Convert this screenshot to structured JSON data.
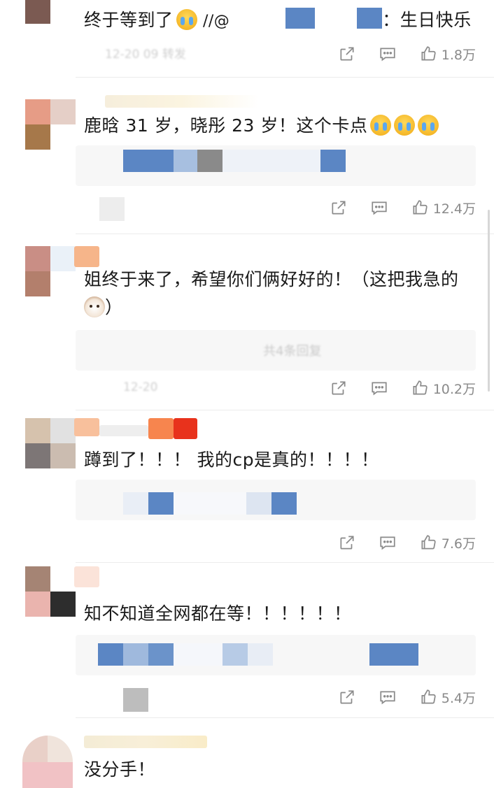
{
  "comments": [
    {
      "text": "终于等到了",
      "mention_prefix": "//@",
      "mention_suffix": "：生日快乐",
      "likes": "1.8万",
      "emoji": "cry-emoji"
    },
    {
      "text": "鹿晗 31 岁，晓彤 23 岁！这个卡点",
      "likes": "12.4万",
      "emoji": "cry-emoji"
    },
    {
      "text_line1": "姐终于来了，希望你们俩好好的！（这把我急的",
      "text_line2": "）",
      "likes": "10.2万",
      "emoji": "cat-emoji"
    },
    {
      "text": "蹲到了！！！ 我的cp是真的！！！！",
      "likes": "7.6万"
    },
    {
      "text": "知不知道全网都在等！！！！！！",
      "likes": "5.4万"
    },
    {
      "text": "没分手！"
    }
  ],
  "icons": {
    "share": "share-icon",
    "comment": "comment-icon",
    "like": "thumbs-up-icon"
  },
  "colors": {
    "mosaic_blue": "#5b86c4",
    "like_gray": "#8a8a8a",
    "text": "#1a1a1a"
  }
}
